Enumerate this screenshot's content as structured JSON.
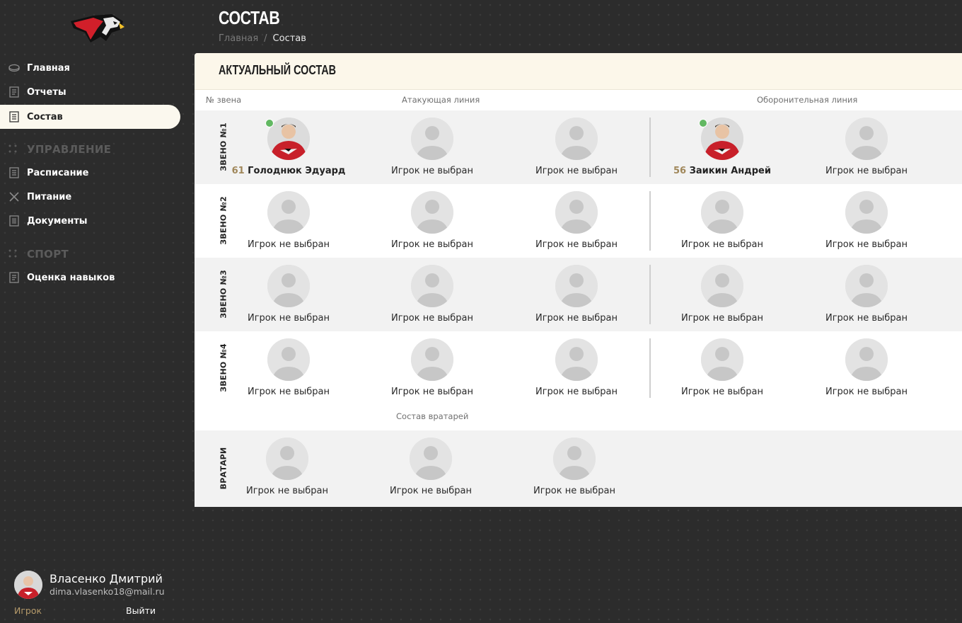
{
  "sidebar": {
    "items": [
      {
        "label": "Главная",
        "icon": "hockey-puck-icon"
      },
      {
        "label": "Отчеты",
        "icon": "report-icon"
      },
      {
        "label": "Состав",
        "icon": "roster-icon",
        "active": true
      }
    ],
    "section_manage": "УПРАВЛЕНИЕ",
    "manage_items": [
      {
        "label": "Расписание",
        "icon": "schedule-icon"
      },
      {
        "label": "Питание",
        "icon": "utensils-icon"
      },
      {
        "label": "Документы",
        "icon": "document-icon"
      }
    ],
    "section_sport": "СПОРТ",
    "sport_items": [
      {
        "label": "Оценка навыков",
        "icon": "skills-icon"
      }
    ]
  },
  "profile": {
    "name": "Власенко Дмитрий",
    "email": "dima.vlasenko18@mail.ru",
    "role": "Игрок",
    "logout": "Выйти"
  },
  "header": {
    "title": "СОСТАВ",
    "breadcrumb_home": "Главная",
    "breadcrumb_sep": "/",
    "breadcrumb_current": "Состав"
  },
  "card": {
    "title": "АКТУАЛЬНЫЙ СОСТАВ",
    "col_line_no": "№ звена",
    "col_attack": "Атакующая линия",
    "col_defense": "Оборонительная линия",
    "goalie_header": "Состав вратарей",
    "empty_slot": "Игрок не выбран"
  },
  "lines": [
    {
      "label": "ЗВЕНО №1",
      "players": [
        {
          "number": "61",
          "name": "Голоднюк Эдуард",
          "online": true
        },
        null,
        null,
        {
          "number": "56",
          "name": "Заикин Андрей",
          "online": true
        },
        null
      ]
    },
    {
      "label": "ЗВЕНО №2",
      "players": [
        null,
        null,
        null,
        null,
        null
      ]
    },
    {
      "label": "ЗВЕНО №3",
      "players": [
        null,
        null,
        null,
        null,
        null
      ]
    },
    {
      "label": "ЗВЕНО №4",
      "players": [
        null,
        null,
        null,
        null,
        null
      ]
    }
  ],
  "goalies": {
    "label": "ВРАТАРИ",
    "players": [
      null,
      null,
      null
    ]
  },
  "colors": {
    "accent": "#a0875a",
    "online": "#62b862",
    "active_nav_bg": "#fbf8ee"
  }
}
